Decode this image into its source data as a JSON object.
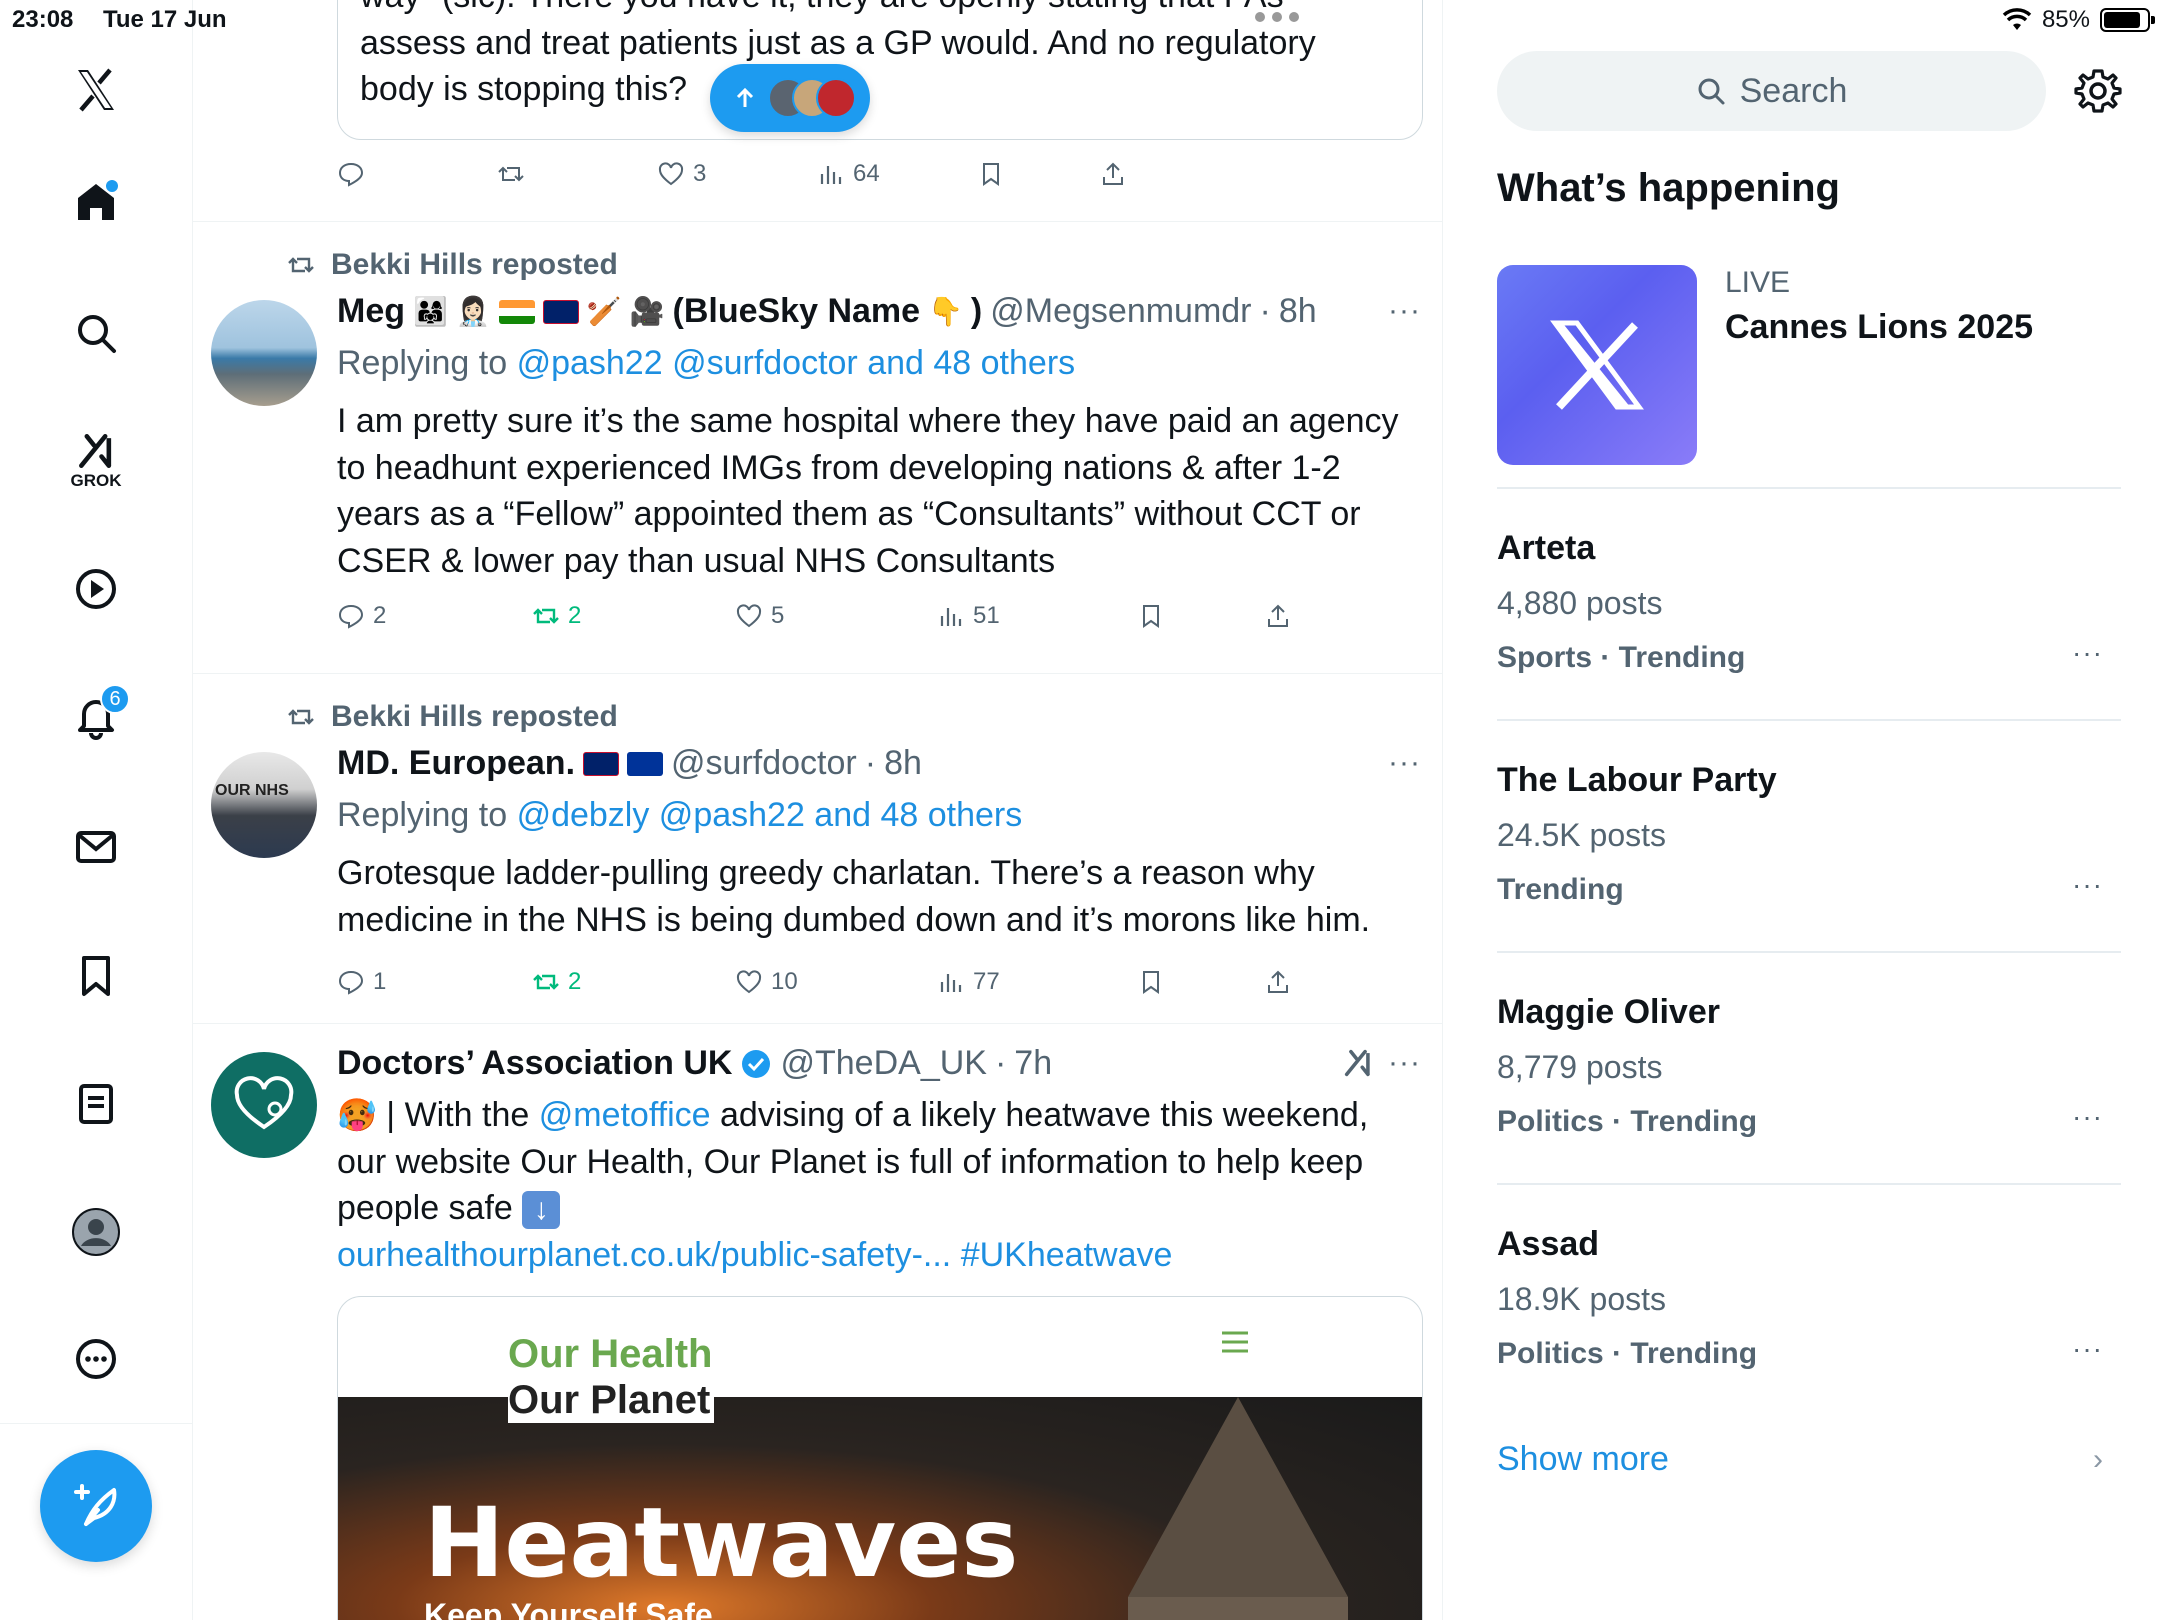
{
  "status_bar": {
    "time": "23:08",
    "date": "Tue 17 Jun",
    "battery": "85%",
    "battery_level": 0.85
  },
  "nav": {
    "grok_label": "GROK",
    "notifications_badge": "6"
  },
  "timeline": {
    "quote_text": [
      "way\" (sic). There you have it, they are openly stating that PAs",
      "assess and treat patients just as a GP would. And no regulatory",
      "body is stopping this?"
    ],
    "post0_actions": {
      "replies": "",
      "reposts": "",
      "likes": "3",
      "views": "64"
    },
    "posts": [
      {
        "repost_by": "Bekki Hills reposted",
        "name": "Meg",
        "name_suffix": "(BlueSky Name",
        "name_close": ")",
        "handle": "@Megsenmumdr",
        "time": "8h",
        "replying_prefix": "Replying to",
        "replying_to": "@pash22 @surfdoctor and 48 others",
        "text": [
          "I am pretty sure it’s the same hospital where they have paid an agency",
          "to headhunt experienced IMGs from developing nations & after 1-2",
          "years as a “Fellow” appointed them as “Consultants” without CCT or",
          "CSER & lower pay than usual NHS Consultants"
        ],
        "actions": {
          "replies": "2",
          "reposts": "2",
          "likes": "5",
          "views": "51"
        }
      },
      {
        "repost_by": "Bekki Hills reposted",
        "name": "MD. European.",
        "handle": "@surfdoctor",
        "time": "8h",
        "replying_prefix": "Replying to",
        "replying_to": "@debzly @pash22 and 48 others",
        "avatar_text": "OUR NHS",
        "text": [
          "Grotesque ladder-pulling greedy charlatan. There’s a reason why",
          "medicine in the NHS is being dumbed down and it’s morons like him."
        ],
        "actions": {
          "replies": "1",
          "reposts": "2",
          "likes": "10",
          "views": "77"
        }
      },
      {
        "name": "Doctors’ Association UK",
        "handle": "@TheDA_UK",
        "time": "7h",
        "text_a": " | With the ",
        "mention": "@metoffice",
        "text_b": " advising of a likely heatwave this weekend,",
        "text_lines": [
          "our website Our Health, Our Planet is full of information to help keep",
          "people safe"
        ],
        "link": "ourhealthourplanet.co.uk/public-safety-...",
        "hashtag": "#UKheatwave",
        "card": {
          "brand_line1": "Our Health",
          "brand_line2": "Our Planet",
          "headline": "Heatwaves",
          "subline": "Keep Yourself Safe"
        }
      }
    ]
  },
  "sidebar": {
    "search_placeholder": "Search",
    "whats_happening": "What’s happening",
    "live": {
      "tag": "LIVE",
      "title": "Cannes Lions 2025"
    },
    "trends": [
      {
        "name": "Arteta",
        "posts": "4,880 posts",
        "category": "Sports · Trending"
      },
      {
        "name": "The Labour Party",
        "posts": "24.5K posts",
        "category": "Trending"
      },
      {
        "name": "Maggie Oliver",
        "posts": "8,779 posts",
        "category": "Politics · Trending"
      },
      {
        "name": "Assad",
        "posts": "18.9K posts",
        "category": "Politics · Trending"
      }
    ],
    "show_more": "Show more"
  },
  "colors": {
    "accent": "#1d9bf0",
    "link": "#1d8fe0",
    "muted": "#536471",
    "repost_green": "#00ba7c",
    "daUK_avatar": "#0f6e64"
  }
}
